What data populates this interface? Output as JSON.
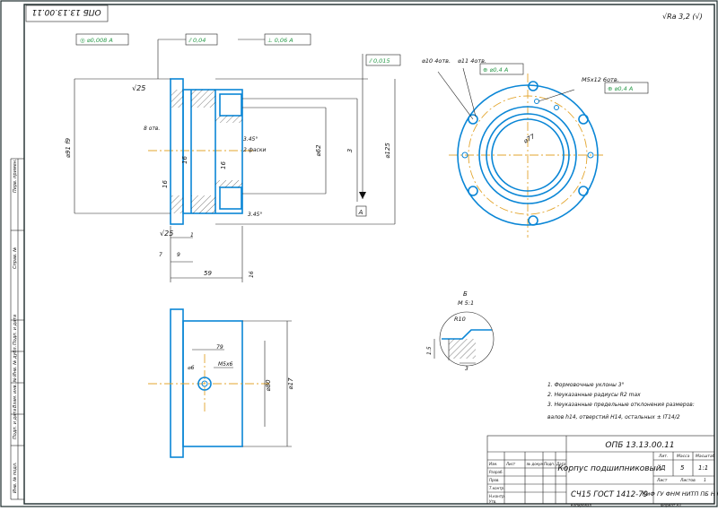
{
  "drawing": {
    "designation": "ОПБ 13.13.00.11",
    "designation_top_mirrored": "ОПБ 13.13.00.11",
    "roughness_corner": "√Ra 3,2 (√)",
    "title": "Корпус подшипниковый",
    "material": "СЧ15 ГОСТ 1412-79",
    "organization": "КиФ ГУ ФНМ\nНИТП ПБ Н ПП",
    "title_block": {
      "lit_label": "Лит.",
      "mass_label": "Масса",
      "scale_label": "Масштаб",
      "lit_value": "Д",
      "mass_value": "5",
      "scale_value": "1:1",
      "sheet_label": "Лист",
      "sheets_label": "Листов",
      "sheets_value": "1",
      "rows": [
        "Изм.",
        "Лист",
        "№ докум.",
        "Подп.",
        "Дата"
      ],
      "roles": [
        "Разраб.",
        "Пров.",
        "Т.контр.",
        "Н.контр.",
        "Утв."
      ],
      "copied": "Копировал",
      "format": "Формат  A3"
    },
    "side_stamp": [
      "Инв. № подл.",
      "Подп. и дата",
      "Взам. инв. №",
      "Инв. № дубл.",
      "Подп. и дата",
      "Справ. №",
      "Перв. примен."
    ]
  },
  "tolerances": {
    "t1": "◎ ⌀0,008  A",
    "t2": "⫽ 0,04",
    "t3": "⊥ 0,06  A",
    "t4": "⫽ 0,015",
    "t5_label": "⌀11 4отв.",
    "t5": "⊕ ⌀0,4  A",
    "t6_label": "М5х12 6отв.",
    "t6": "⊕ ⌀0,4  A",
    "t7_label": "⌀10 4отв."
  },
  "dimensions": {
    "d1": "⌀91 f9",
    "d2": "⌀62",
    "d3": "3",
    "d4": "⌀125",
    "r25a": "√25",
    "r25b": "√25",
    "holes": "8 отв.",
    "chamfer1": "3.45°",
    "chamfer1b": "2 фаски",
    "chamfer2": "3.45°",
    "w16a": "16",
    "w16b": "16",
    "w16c": "16",
    "d1b": "1",
    "d7": "7",
    "d9": "9",
    "d59": "59",
    "d16": "16",
    "datum": "A",
    "d79": "79",
    "m5": "М5х6",
    "d6": "⌀6",
    "d80": "⌀80",
    "d17": "⌀17",
    "detail_label": "Б",
    "detail_scale": "М 5:1",
    "r10": "R10",
    "d15": "1.5",
    "phi77": "⌀77",
    "phi10": "⌀10"
  },
  "notes": [
    "1. Формовочные уклоны 3°",
    "2. Неуказанные радиусы R2 max",
    "3. Неуказанные предельные отклонения размеров:",
    "валов h14, отверстий H14, остальных ± IT14/2"
  ]
}
